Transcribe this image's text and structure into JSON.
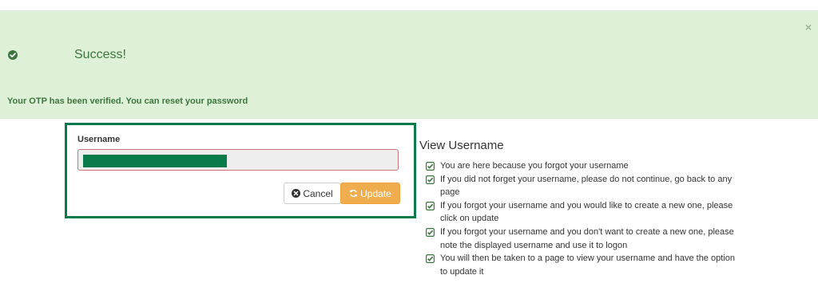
{
  "alert": {
    "title": "Success!",
    "message": "Your OTP has been verified. You can reset your password",
    "close_symbol": "×",
    "icon": "check-circle-icon",
    "color": "#3c763d",
    "background": "#dff0d8"
  },
  "form": {
    "username_label": "Username",
    "username_value": "",
    "cancel_label": "Cancel",
    "update_label": "Update",
    "cancel_icon": "times-circle-icon",
    "update_icon": "refresh-icon",
    "border_color": "#0a7a4b",
    "update_color": "#f0ad4e"
  },
  "info": {
    "title": "View Username",
    "item_icon": "check-square-icon",
    "items": [
      "You are here because you forgot your username",
      "If you did not forget your username, please do not continue, go back to any page",
      "If you forgot your username and you would like to create a new one, please click on update",
      "If you forgot your username and you don't want to create a new one, please note the displayed username and use it to logon",
      "You will then be taken to a page to view your username and have the option to update it"
    ]
  }
}
